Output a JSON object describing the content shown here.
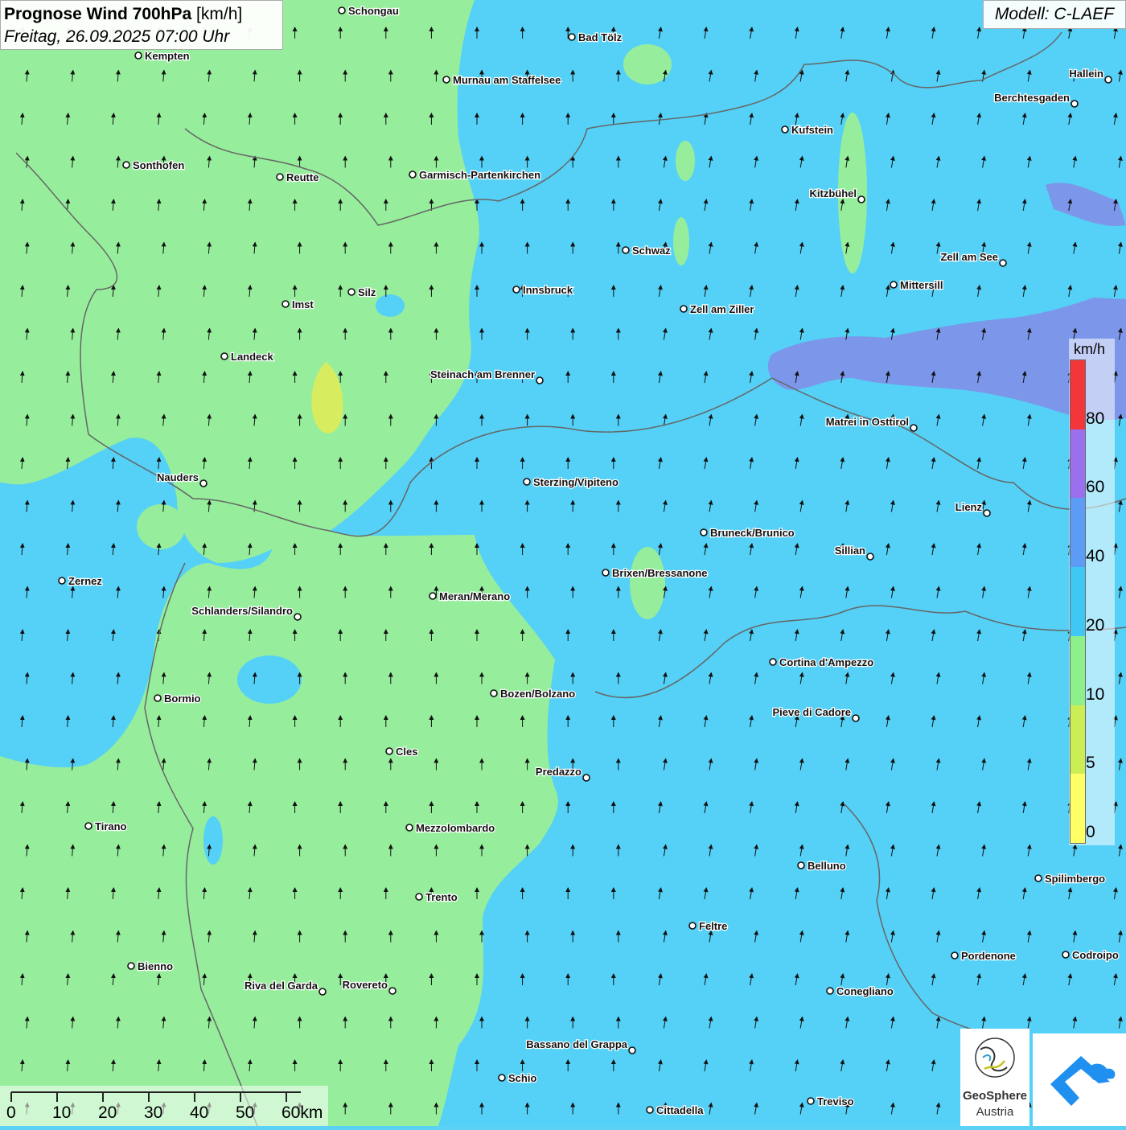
{
  "header": {
    "title": "Prognose Wind 700hPa",
    "unit": "[km/h]",
    "datetime": "Freitag, 26.09.2025 07:00 Uhr"
  },
  "model": "Modell: C-LAEF",
  "legend": {
    "unit": "km/h",
    "classes": [
      {
        "label": "0",
        "color": "#ffff66"
      },
      {
        "label": "5",
        "color": "#ccee55"
      },
      {
        "label": "10",
        "color": "#8ef08c"
      },
      {
        "label": "20",
        "color": "#3fc8f4"
      },
      {
        "label": "40",
        "color": "#5c9cf6"
      },
      {
        "label": "60",
        "color": "#9a70ee"
      },
      {
        "label": "80",
        "color": "#f2363a"
      }
    ]
  },
  "fields": {
    "low_wind_color": "#96ee9c",
    "mid_wind_color": "#55d0f6",
    "high_wind_color": "#7c96ea",
    "calm_color": "#d8ec60"
  },
  "scale": {
    "labels": [
      "0",
      "10",
      "20",
      "30",
      "40",
      "50",
      "60km"
    ]
  },
  "logos": {
    "geo_line1": "GeoSphere",
    "geo_line2": "Austria"
  },
  "cities": [
    {
      "name": "Schongau"
    },
    {
      "name": "Kempten"
    },
    {
      "name": "Bad Tölz"
    },
    {
      "name": "Murnau am Staffelsee"
    },
    {
      "name": "Hallein"
    },
    {
      "name": "Berchtesgaden"
    },
    {
      "name": "Kufstein"
    },
    {
      "name": "Sonthofen"
    },
    {
      "name": "Reutte"
    },
    {
      "name": "Garmisch-Partenkirchen"
    },
    {
      "name": "Kitzbühel"
    },
    {
      "name": "Schwaz"
    },
    {
      "name": "Zell am See"
    },
    {
      "name": "Mittersill"
    },
    {
      "name": "Innsbruck"
    },
    {
      "name": "Imst"
    },
    {
      "name": "Silz"
    },
    {
      "name": "Zell am Ziller"
    },
    {
      "name": "Landeck"
    },
    {
      "name": "Steinach am Brenner"
    },
    {
      "name": "Matrei in Osttirol"
    },
    {
      "name": "Nauders"
    },
    {
      "name": "Sterzing/Vipiteno"
    },
    {
      "name": "Lienz"
    },
    {
      "name": "Bruneck/Brunico"
    },
    {
      "name": "Sillian"
    },
    {
      "name": "Brixen/Bressanone"
    },
    {
      "name": "Zernez"
    },
    {
      "name": "Meran/Merano"
    },
    {
      "name": "Schlanders/Silandro"
    },
    {
      "name": "Cortina d'Ampezzo"
    },
    {
      "name": "Bozen/Bolzano"
    },
    {
      "name": "Bormio"
    },
    {
      "name": "Pieve di Cadore"
    },
    {
      "name": "Cles"
    },
    {
      "name": "Predazzo"
    },
    {
      "name": "Tirano"
    },
    {
      "name": "Mezzolombardo"
    },
    {
      "name": "Belluno"
    },
    {
      "name": "Spilimbergo"
    },
    {
      "name": "Trento"
    },
    {
      "name": "Feltre"
    },
    {
      "name": "Pordenone"
    },
    {
      "name": "Codroipo"
    },
    {
      "name": "Bienno"
    },
    {
      "name": "Riva del Garda"
    },
    {
      "name": "Rovereto"
    },
    {
      "name": "Conegliano"
    },
    {
      "name": "Bassano del Grappa"
    },
    {
      "name": "Schio"
    },
    {
      "name": "Treviso"
    },
    {
      "name": "Cittadella"
    }
  ]
}
